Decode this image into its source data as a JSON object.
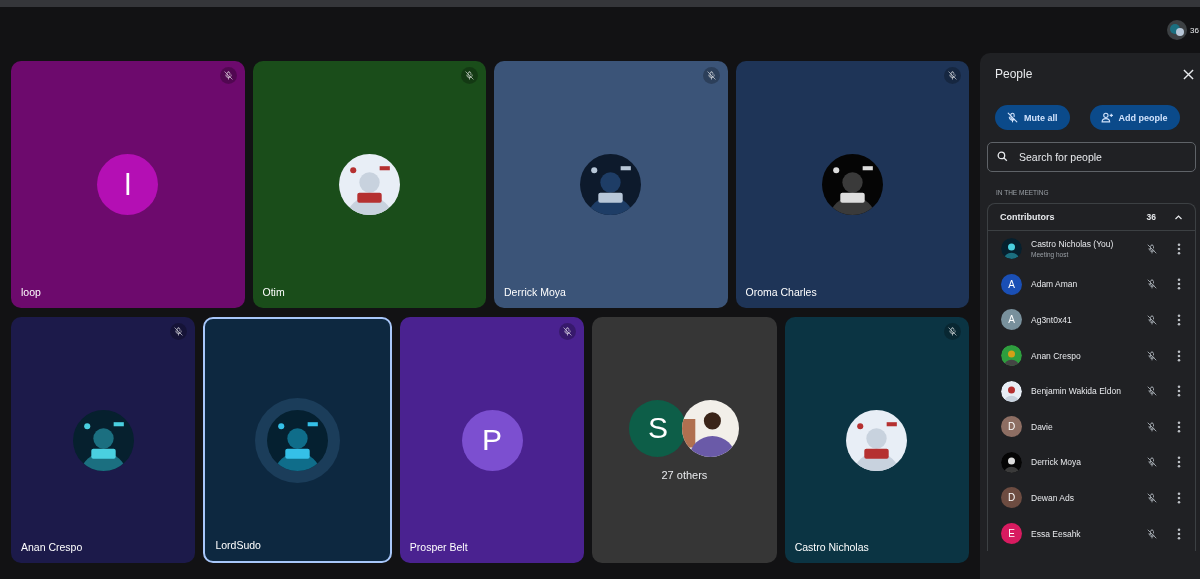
{
  "header": {
    "participant_count": "36"
  },
  "tiles": [
    {
      "name": "loop",
      "kind": "letter",
      "avatar": {
        "letter": "l",
        "color": "#b40fb4"
      },
      "color": "#6d0a6d",
      "muted": true,
      "speaking": false
    },
    {
      "name": "Otim",
      "kind": "picture",
      "color": "#1a4d1a",
      "muted": true,
      "speaking": false
    },
    {
      "name": "Derrick Moya",
      "kind": "picture",
      "color": "#3b5478",
      "muted": true,
      "speaking": false
    },
    {
      "name": "Oroma Charles",
      "kind": "picture",
      "color": "#1e3457",
      "muted": true,
      "speaking": false
    },
    {
      "name": "Anan Crespo",
      "kind": "picture",
      "color": "#1c1a4a",
      "muted": true,
      "speaking": false
    },
    {
      "name": "LordSudo",
      "kind": "picture",
      "color": "#0d2840",
      "muted": false,
      "speaking": true
    },
    {
      "name": "Prosper Belt",
      "kind": "letter",
      "avatar": {
        "letter": "P",
        "color": "#7c4fd0"
      },
      "color": "#4a2290",
      "muted": true,
      "speaking": false
    },
    {
      "kind": "others",
      "avatar": {
        "letter": "S",
        "color": "#0d5e48"
      },
      "caption": "27 others",
      "color": "#363636",
      "muted": false,
      "speaking": false
    },
    {
      "name": "Castro Nicholas",
      "kind": "picture",
      "color": "#0b3443",
      "muted": true,
      "speaking": false
    }
  ],
  "people_panel": {
    "title": "People",
    "mute_all": "Mute all",
    "add_people": "Add people",
    "search": {
      "placeholder": "Search for people"
    },
    "section": "IN THE MEETING",
    "group": {
      "label": "Contributors",
      "count": "36",
      "expanded": true
    },
    "participants": [
      {
        "name": "Castro Nicholas (You)",
        "subtitle": "Meeting host",
        "kind": "picture"
      },
      {
        "name": "Adam Aman",
        "kind": "letter",
        "letter": "A",
        "color": "#1a4fb5"
      },
      {
        "name": "Ag3nt0x41",
        "kind": "letter",
        "letter": "A",
        "color": "#78909c"
      },
      {
        "name": "Anan Crespo",
        "kind": "picture"
      },
      {
        "name": "Benjamin Wakida Eldon",
        "kind": "picture"
      },
      {
        "name": "Davie",
        "kind": "letter",
        "letter": "D",
        "color": "#8d6e63"
      },
      {
        "name": "Derrick Moya",
        "kind": "picture"
      },
      {
        "name": "Dewan Ads",
        "kind": "letter",
        "letter": "D",
        "color": "#6d4c41"
      },
      {
        "name": "Essa Eesahk",
        "kind": "letter",
        "letter": "E",
        "color": "#d81b60"
      }
    ]
  }
}
